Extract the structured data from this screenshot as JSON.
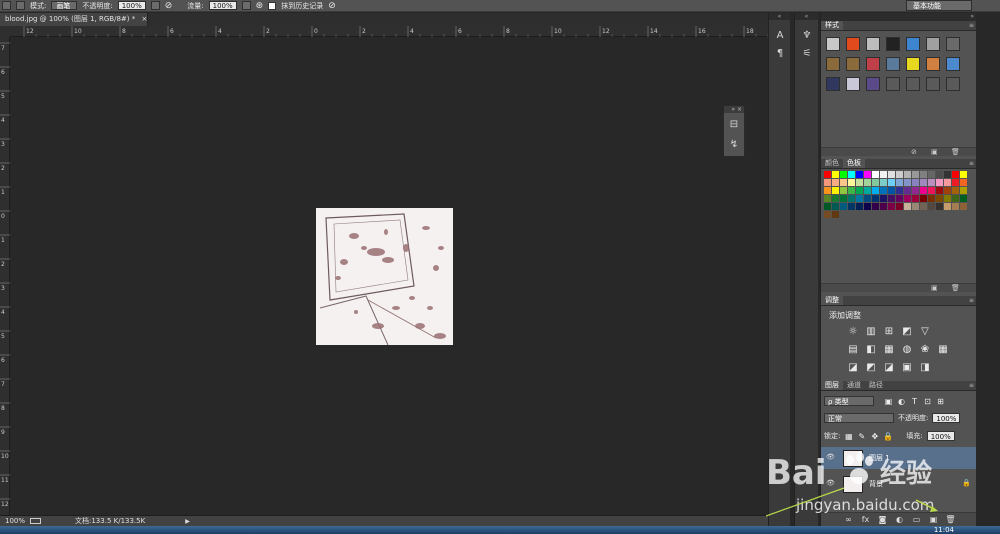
{
  "options_bar": {
    "mode_label": "模式:",
    "mode_value": "画笔",
    "opacity_label": "不透明度:",
    "opacity_value": "100%",
    "flow_label": "流量:",
    "flow_value": "100%",
    "history_label": "抹到历史记录",
    "workspace": "基本功能"
  },
  "document": {
    "tab_title": "blood.jpg @ 100% (图层 1, RGB/8#) *",
    "tab_close": "×",
    "ruler_h_labels": [
      "12",
      "10",
      "8",
      "6",
      "4",
      "2",
      "0",
      "2",
      "4",
      "6",
      "8",
      "10",
      "12",
      "14",
      "16",
      "18"
    ],
    "ruler_v_labels": [
      "7",
      "6",
      "5",
      "4",
      "3",
      "2",
      "1",
      "0",
      "1",
      "2",
      "3",
      "4",
      "5",
      "6",
      "7",
      "8",
      "9",
      "10",
      "11",
      "12"
    ]
  },
  "status": {
    "zoom": "100%",
    "doc_info": "文档:133.5 K/133.5K"
  },
  "taskbar": {
    "clock": "11:04"
  },
  "panels": {
    "styles": {
      "tab": "样式",
      "swatches": [
        "#c8c8c8",
        "#e04a1c",
        "#bdbdbd",
        "#222222",
        "#3d86cf",
        "#a0a0a0",
        "#6a6a6a",
        "#8a6a3a",
        "#8b6a3c",
        "#c0404a",
        "#5a7a9a",
        "#e8d820",
        "#d08040",
        "#4a8acd",
        "#303860",
        "#c8c8d8",
        "#5a4a8a",
        "#5a5a5a",
        "#5a5a5a",
        "#5a5a5a",
        "#5a5a5a"
      ]
    },
    "swatches_panel": {
      "tabs": [
        "颜色",
        "色板"
      ],
      "colors": [
        "#ff0000",
        "#ffff00",
        "#00ff00",
        "#00ffff",
        "#0000ff",
        "#ff00ff",
        "#ffffff",
        "#f2f2f2",
        "#e0e0e0",
        "#cccccc",
        "#b3b3b3",
        "#999999",
        "#808080",
        "#666666",
        "#4d4d4d",
        "#333333",
        "#ff0000",
        "#ffff00",
        "#f7977a",
        "#f9ad81",
        "#fdc68a",
        "#fff79a",
        "#c4df9b",
        "#a3d39c",
        "#82ca9d",
        "#7bcdc8",
        "#6ecff6",
        "#7ea7d8",
        "#8493ca",
        "#8882be",
        "#a187be",
        "#bc8dbf",
        "#f49ac2",
        "#f6989d",
        "#ed1c24",
        "#f26522",
        "#f7941d",
        "#fff200",
        "#8dc73f",
        "#39b54a",
        "#00a651",
        "#00a99d",
        "#00aeef",
        "#0072bc",
        "#0054a6",
        "#2e3192",
        "#662d91",
        "#92278f",
        "#ec008c",
        "#ed145b",
        "#9e0b0f",
        "#a0410d",
        "#a36209",
        "#aba000",
        "#598527",
        "#1a7b30",
        "#007236",
        "#00746b",
        "#0076a3",
        "#004b80",
        "#003471",
        "#1b1464",
        "#440e62",
        "#630460",
        "#9e005d",
        "#9e0039",
        "#790000",
        "#7b2e00",
        "#7d4900",
        "#827b00",
        "#406618",
        "#005e20",
        "#005826",
        "#005952",
        "#005b7f",
        "#003663",
        "#002157",
        "#0d004c",
        "#32004b",
        "#4b0049",
        "#7b0046",
        "#7a0026",
        "#c7b299",
        "#998675",
        "#736357",
        "#534741",
        "#37302d",
        "#c69c6d",
        "#a67c52",
        "#8c6239",
        "#754c24",
        "#603913"
      ]
    },
    "adjustments": {
      "tab": "调整",
      "subtitle": "添加调整",
      "row1": [
        "☼",
        "▥",
        "⊞",
        "◩",
        "▽"
      ],
      "row2": [
        "▤",
        "◧",
        "▦",
        "◍",
        "❀",
        "▦"
      ],
      "row3": [
        "◪",
        "◩",
        "◪",
        "▣",
        "◨"
      ]
    },
    "layers": {
      "tabs": [
        "图层",
        "通道",
        "路径"
      ],
      "kind_label": "ρ 类型",
      "blend_mode": "正常",
      "opacity_label": "不透明度:",
      "opacity_value": "100%",
      "lock_label": "锁定:",
      "fill_label": "填充:",
      "fill_value": "100%",
      "layer1_name": "图层 1",
      "layer2_name": "背景",
      "footer_icons": [
        "∞",
        "fx",
        "◙",
        "◐",
        "▭",
        "▣",
        "🗑"
      ]
    }
  },
  "watermark": {
    "brand": "Bai",
    "brand2": "经验",
    "url": "jingyan.baidu.com"
  }
}
